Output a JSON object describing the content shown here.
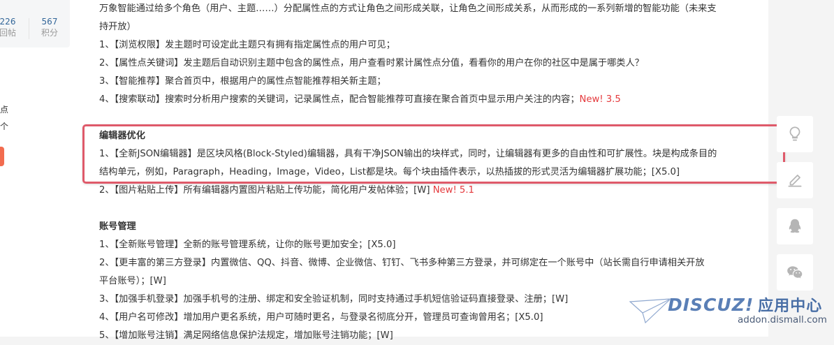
{
  "user_stats": {
    "replies": {
      "value": "226",
      "label": "回帖"
    },
    "points": {
      "value": "567",
      "label": "积分"
    }
  },
  "sidebar_fragments": [
    "点",
    "个"
  ],
  "paragraphs": {
    "p1a": "万象智能通过给多个角色（用户、主题……）分配属性点的方式让角色之间形成关联，让角色之间形成关系，从而形成的一系列新增的智能功能（未来支",
    "p1b": "持开放）",
    "i1": "1、【浏览权限】发主题时可设定此主题只有拥有指定属性点的用户可见；",
    "i2": "2、【属性点关键词】发主题后自动识别主题中包含的属性点，用户查看时累计属性点分值，看看你的用户在你的社区中是属于哪类人？",
    "i3": "3、【智能推荐】聚合首页中，根据用户的属性点智能推荐相关新主题；",
    "i4": "4、【搜索联动】搜索时分析用户搜索的关键词，记录属性点，配合智能推荐可直接在聚合首页中显示用户关注的内容；",
    "i4_new": "New! 3.5"
  },
  "editor_section": {
    "title": "编辑器优化",
    "i1a": "1、【全新JSON编辑器】是区块风格(Block-Styled)编辑器，具有干净JSON输出的块样式，同时，让编辑器有更多的自由性和可扩展性。块是构成条目的",
    "i1b": "结构单元，例如，Paragraph，Heading，Image，Video，List都是块。每个块由插件表示，以热插拔的形式灵活为编辑器扩展功能；[X5.0]",
    "i2": "2、【图片粘贴上传】所有编辑器内置图片粘贴上传功能，简化用户发帖体验；[W] ",
    "i2_new": "New! 5.1"
  },
  "account_section": {
    "title": "账号管理",
    "i1": "1、【全新账号管理】全新的账号管理系统，让你的账号更加安全；[X5.0]",
    "i2a": "2、【更丰富的第三方登录】内置微信、QQ、抖音、微博、企业微信、钉钉、飞书多种第三方登录，并可绑定在一个账号中（站长需自行申请相关开放",
    "i2b": "平台账号）；[W]",
    "i3": "3、【加强手机登录】加强手机号的注册、绑定和安全验证机制，同时支持通过手机短信验证码直接登录、注册；[W]",
    "i4": "4、【用户名可修改】增加用户更名系统，用户可随时更名，与登录名彻底分开，管理员可查询曾用名；[X5.0]",
    "i5": "5、【增加账号注销】满足网络信息保护法规定，增加账号注销功能；[W]"
  },
  "tools": [
    "lightbulb-icon",
    "edit-icon",
    "qq-icon",
    "wechat-icon"
  ],
  "watermark": {
    "logo": "DISCUZ!",
    "logo_cn": "应用中心",
    "url": "addon.dismall.com"
  },
  "colors": {
    "highlight": "#df5a6a",
    "new_badge": "#e4393c",
    "stat_num": "#336699"
  }
}
